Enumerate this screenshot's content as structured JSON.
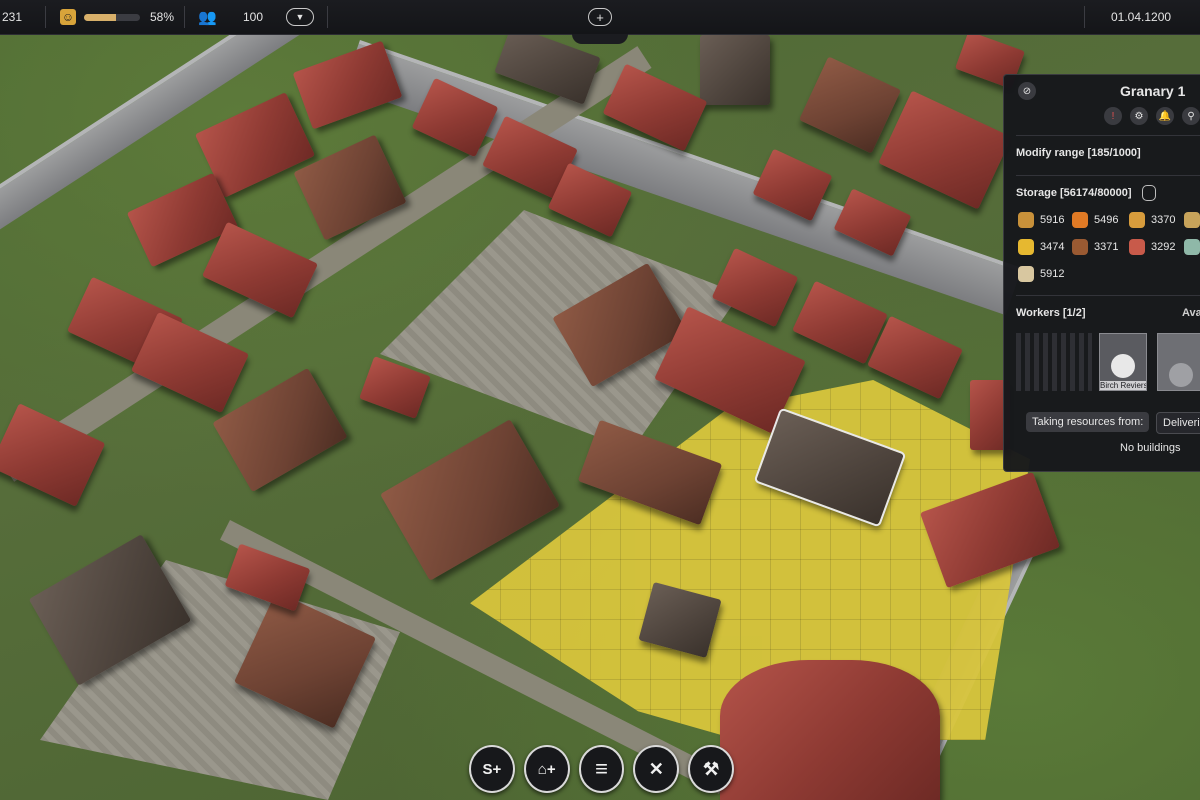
{
  "topbar": {
    "population_count": "231",
    "happiness_icon": "mask-icon",
    "happiness_percent": "58%",
    "happiness_level": 0.58,
    "workers_icon": "people-icon",
    "worker_count": "100",
    "dropdown_glyph": "▼",
    "add_glyph": "+",
    "date": "01.04.1200"
  },
  "panel": {
    "title": "Granary 1",
    "modify_range": "Modify range [185/1000]",
    "storage_label": "Storage [56174/80000]",
    "resources": [
      {
        "name": "bread",
        "value": "5916",
        "color": "#c8913a"
      },
      {
        "name": "carrot",
        "value": "5496",
        "color": "#e07a25"
      },
      {
        "name": "honey",
        "value": "3370",
        "color": "#d79c3c"
      },
      {
        "name": "cheese",
        "value": "3474",
        "color": "#e6b830"
      },
      {
        "name": "smoked-meat",
        "value": "3371",
        "color": "#9a5a32"
      },
      {
        "name": "meat",
        "value": "3292",
        "color": "#c85a4a"
      },
      {
        "name": "flour",
        "value": "5912",
        "color": "#d8c7a0"
      }
    ],
    "workers_label": "Workers [1/2]",
    "available_label": "Ava",
    "worker_name": "Birch Reviers",
    "taking_from_label": "Taking resources from:",
    "delivering_label": "Deliverin",
    "no_buildings": "No buildings"
  },
  "toolbar": [
    {
      "name": "build-production-icon",
      "glyph": "S+"
    },
    {
      "name": "build-house-icon",
      "glyph": "⌂+"
    },
    {
      "name": "documents-icon",
      "glyph": "≡"
    },
    {
      "name": "military-icon",
      "glyph": "✕"
    },
    {
      "name": "demolish-hammer-icon",
      "glyph": "⚒"
    }
  ]
}
